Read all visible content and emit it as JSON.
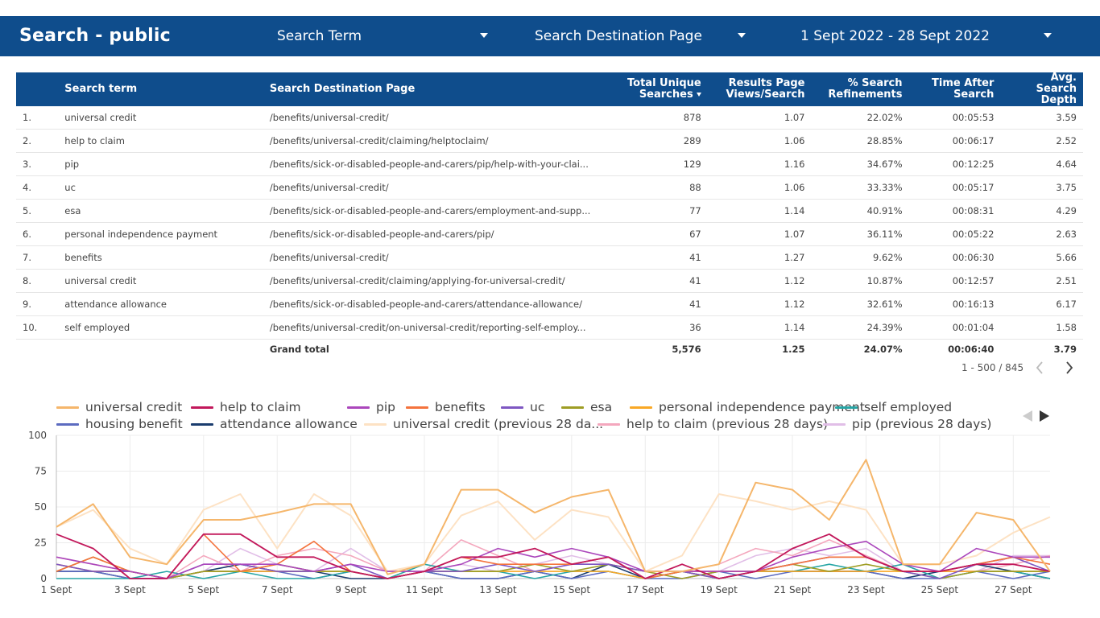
{
  "header": {
    "title": "Search - public",
    "filter_search_term": "Search Term",
    "filter_destination": "Search Destination Page",
    "date_range": "1 Sept 2022 - 28 Sept 2022"
  },
  "table": {
    "columns": [
      "Search term",
      "Search Destination Page",
      "Total Unique Searches",
      "Results Page Views/Search",
      "% Search Refinements",
      "Time After Search",
      "Avg. Search Depth"
    ],
    "rows": [
      {
        "idx": "1.",
        "term": "universal credit",
        "page": "/benefits/universal-credit/",
        "searches": "878",
        "views": "1.07",
        "refine": "22.02%",
        "time": "00:05:53",
        "depth": "3.59"
      },
      {
        "idx": "2.",
        "term": "help to claim",
        "page": "/benefits/universal-credit/claiming/helptoclaim/",
        "searches": "289",
        "views": "1.06",
        "refine": "28.85%",
        "time": "00:06:17",
        "depth": "2.52"
      },
      {
        "idx": "3.",
        "term": "pip",
        "page": "/benefits/sick-or-disabled-people-and-carers/pip/help-with-your-clai...",
        "searches": "129",
        "views": "1.16",
        "refine": "34.67%",
        "time": "00:12:25",
        "depth": "4.64"
      },
      {
        "idx": "4.",
        "term": "uc",
        "page": "/benefits/universal-credit/",
        "searches": "88",
        "views": "1.06",
        "refine": "33.33%",
        "time": "00:05:17",
        "depth": "3.75"
      },
      {
        "idx": "5.",
        "term": "esa",
        "page": "/benefits/sick-or-disabled-people-and-carers/employment-and-supp...",
        "searches": "77",
        "views": "1.14",
        "refine": "40.91%",
        "time": "00:08:31",
        "depth": "4.29"
      },
      {
        "idx": "6.",
        "term": "personal independence payment",
        "page": "/benefits/sick-or-disabled-people-and-carers/pip/",
        "searches": "67",
        "views": "1.07",
        "refine": "36.11%",
        "time": "00:05:22",
        "depth": "2.63"
      },
      {
        "idx": "7.",
        "term": "benefits",
        "page": "/benefits/universal-credit/",
        "searches": "41",
        "views": "1.27",
        "refine": "9.62%",
        "time": "00:06:30",
        "depth": "5.66"
      },
      {
        "idx": "8.",
        "term": "universal credit",
        "page": "/benefits/universal-credit/claiming/applying-for-universal-credit/",
        "searches": "41",
        "views": "1.12",
        "refine": "10.87%",
        "time": "00:12:57",
        "depth": "2.51"
      },
      {
        "idx": "9.",
        "term": "attendance allowance",
        "page": "/benefits/sick-or-disabled-people-and-carers/attendance-allowance/",
        "searches": "41",
        "views": "1.12",
        "refine": "32.61%",
        "time": "00:16:13",
        "depth": "6.17"
      },
      {
        "idx": "10.",
        "term": "self employed",
        "page": "/benefits/universal-credit/on-universal-credit/reporting-self-employ...",
        "searches": "36",
        "views": "1.14",
        "refine": "24.39%",
        "time": "00:01:04",
        "depth": "1.58"
      }
    ],
    "total": {
      "label": "Grand total",
      "searches": "5,576",
      "views": "1.25",
      "refine": "24.07%",
      "time": "00:06:40",
      "depth": "3.79"
    }
  },
  "pager": {
    "range": "1 - 500 / 845",
    "prev_icon": "chevron-left-icon",
    "next_icon": "chevron-right-icon"
  },
  "chart_data": {
    "type": "line",
    "x": [
      "1 Sept",
      "2 Sept",
      "3 Sept",
      "4 Sept",
      "5 Sept",
      "6 Sept",
      "7 Sept",
      "8 Sept",
      "9 Sept",
      "10 Sept",
      "11 Sept",
      "12 Sept",
      "13 Sept",
      "14 Sept",
      "15 Sept",
      "16 Sept",
      "17 Sept",
      "18 Sept",
      "19 Sept",
      "20 Sept",
      "21 Sept",
      "22 Sept",
      "23 Sept",
      "24 Sept",
      "25 Sept",
      "26 Sept",
      "27 Sept",
      "28 Sept"
    ],
    "x_tick_labels": [
      "1 Sept",
      "3 Sept",
      "5 Sept",
      "7 Sept",
      "9 Sept",
      "11 Sept",
      "13 Sept",
      "15 Sept",
      "17 Sept",
      "19 Sept",
      "21 Sept",
      "23 Sept",
      "25 Sept",
      "27 Sept"
    ],
    "y_ticks": [
      0,
      25,
      50,
      75,
      100
    ],
    "ylim": [
      0,
      100
    ],
    "grid": true,
    "legend_position": "top",
    "series": [
      {
        "name": "universal credit",
        "color": "#f5b66b",
        "width": 2,
        "values": [
          36,
          52,
          15,
          10,
          41,
          41,
          46,
          52,
          52,
          3,
          10,
          62,
          62,
          46,
          57,
          62,
          5,
          5,
          10,
          67,
          62,
          41,
          83,
          10,
          10,
          46,
          41,
          5
        ]
      },
      {
        "name": "help to claim",
        "color": "#c2185b",
        "width": 1.8,
        "values": [
          31,
          21,
          0,
          0,
          31,
          31,
          15,
          15,
          5,
          0,
          5,
          15,
          15,
          21,
          10,
          15,
          0,
          10,
          0,
          5,
          21,
          31,
          15,
          5,
          5,
          10,
          10,
          5
        ]
      },
      {
        "name": "pip",
        "color": "#ab47bc",
        "width": 1.6,
        "values": [
          15,
          10,
          5,
          0,
          10,
          10,
          10,
          5,
          10,
          5,
          5,
          10,
          21,
          15,
          21,
          15,
          5,
          5,
          5,
          5,
          15,
          21,
          26,
          10,
          5,
          21,
          15,
          15
        ]
      },
      {
        "name": "benefits",
        "color": "#f4733d",
        "width": 1.6,
        "values": [
          5,
          15,
          5,
          0,
          31,
          5,
          10,
          26,
          5,
          0,
          5,
          15,
          10,
          10,
          10,
          15,
          0,
          5,
          5,
          5,
          10,
          15,
          15,
          5,
          5,
          10,
          15,
          10
        ]
      },
      {
        "name": "uc",
        "color": "#7e57c2",
        "width": 1.6,
        "values": [
          10,
          5,
          5,
          0,
          10,
          10,
          5,
          5,
          10,
          0,
          5,
          5,
          10,
          5,
          10,
          10,
          5,
          5,
          0,
          5,
          10,
          15,
          15,
          5,
          0,
          10,
          15,
          5
        ]
      },
      {
        "name": "esa",
        "color": "#9e9d24",
        "width": 1.6,
        "values": [
          5,
          15,
          5,
          0,
          5,
          5,
          10,
          5,
          5,
          0,
          5,
          5,
          5,
          10,
          5,
          10,
          5,
          0,
          5,
          5,
          10,
          5,
          10,
          5,
          0,
          5,
          5,
          5
        ]
      },
      {
        "name": "personal independence payment",
        "color": "#f9a825",
        "width": 1.6,
        "values": [
          10,
          5,
          5,
          0,
          5,
          5,
          5,
          5,
          5,
          0,
          5,
          5,
          5,
          5,
          5,
          5,
          0,
          5,
          0,
          5,
          5,
          5,
          5,
          5,
          5,
          5,
          5,
          5
        ]
      },
      {
        "name": "self employed",
        "color": "#26a5a5",
        "width": 1.6,
        "values": [
          0,
          0,
          0,
          5,
          0,
          5,
          0,
          0,
          5,
          0,
          10,
          5,
          5,
          0,
          5,
          5,
          0,
          5,
          0,
          5,
          5,
          10,
          5,
          10,
          0,
          5,
          5,
          0
        ]
      },
      {
        "name": "housing benefit",
        "color": "#5c6bc0",
        "width": 1.6,
        "values": [
          5,
          5,
          0,
          0,
          5,
          5,
          5,
          0,
          5,
          0,
          5,
          0,
          0,
          5,
          0,
          5,
          0,
          0,
          5,
          0,
          5,
          5,
          5,
          0,
          0,
          5,
          0,
          5
        ]
      },
      {
        "name": "attendance allowance",
        "color": "#1a3c6e",
        "width": 1.6,
        "values": [
          5,
          5,
          0,
          0,
          5,
          10,
          5,
          5,
          0,
          0,
          5,
          0,
          0,
          5,
          0,
          10,
          0,
          5,
          0,
          5,
          5,
          5,
          5,
          0,
          5,
          10,
          5,
          0
        ]
      },
      {
        "name": "universal credit (previous 28 da...",
        "color": "#fde2c4",
        "width": 2,
        "values": [
          36,
          48,
          21,
          10,
          48,
          59,
          21,
          59,
          44,
          5,
          10,
          44,
          54,
          27,
          48,
          43,
          5,
          16,
          59,
          54,
          48,
          54,
          48,
          10,
          10,
          16,
          32,
          43
        ]
      },
      {
        "name": "help to claim (previous 28 days)",
        "color": "#f4a7bd",
        "width": 1.6,
        "values": [
          15,
          10,
          5,
          0,
          16,
          5,
          16,
          21,
          16,
          5,
          5,
          27,
          16,
          5,
          10,
          10,
          5,
          5,
          10,
          21,
          16,
          27,
          16,
          5,
          5,
          5,
          10,
          16
        ]
      },
      {
        "name": "pip (previous 28 days)",
        "color": "#e1bee7",
        "width": 1.6,
        "values": [
          10,
          5,
          5,
          0,
          5,
          21,
          10,
          5,
          21,
          5,
          5,
          10,
          5,
          10,
          16,
          10,
          5,
          5,
          5,
          16,
          21,
          16,
          21,
          5,
          5,
          5,
          16,
          16
        ]
      }
    ]
  }
}
